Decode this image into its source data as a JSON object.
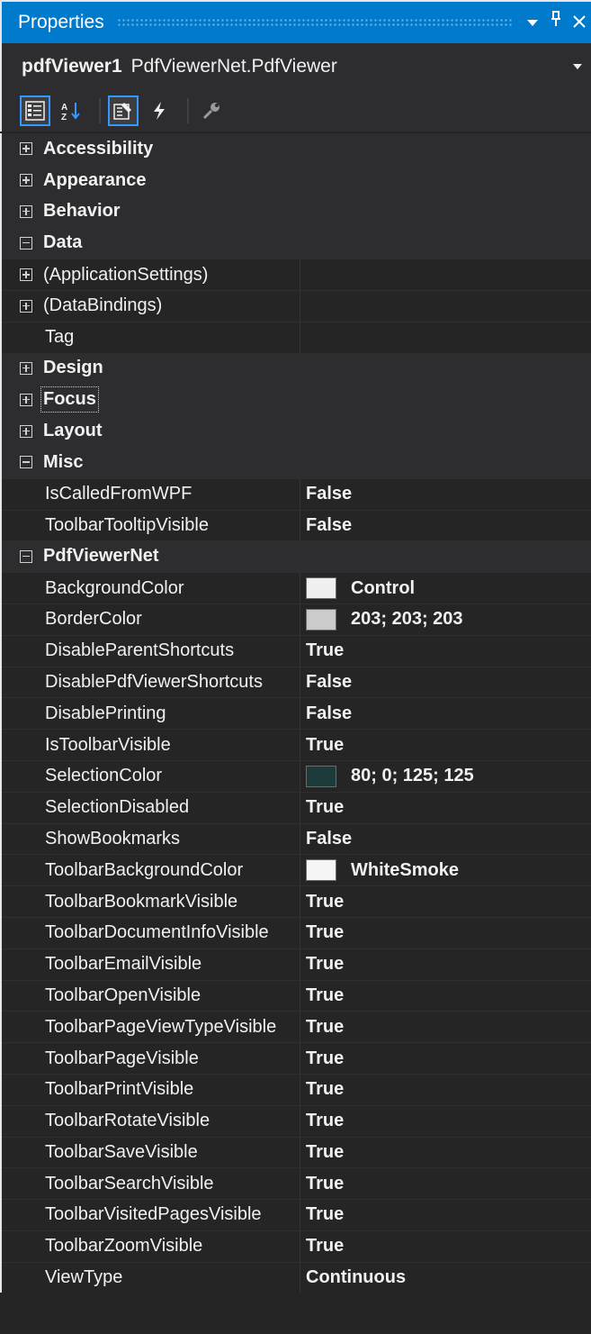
{
  "window": {
    "title": "Properties",
    "pin_glyph": "â ¦",
    "close_glyph": "Ã"
  },
  "object_selector": {
    "name": "pdfViewer1",
    "type": "PdfViewerNet.PdfViewer"
  },
  "toolbar": {
    "buttons": [
      "categorized-icon",
      "alphabetical-icon",
      "properties-icon",
      "events-icon",
      "property-pages-icon"
    ]
  },
  "colors": {
    "accent": "#007acc",
    "background": "#252526",
    "category_row": "#2d2d30",
    "text": "#f1f1f1"
  },
  "rows": [
    {
      "kind": "category",
      "expanded": false,
      "label": "Accessibility"
    },
    {
      "kind": "category",
      "expanded": false,
      "label": "Appearance"
    },
    {
      "kind": "category",
      "expanded": false,
      "label": "Behavior"
    },
    {
      "kind": "category",
      "expanded": true,
      "label": "Data"
    },
    {
      "kind": "property",
      "expandable": true,
      "label": "(ApplicationSettings)",
      "value": ""
    },
    {
      "kind": "property",
      "expandable": true,
      "label": "(DataBindings)",
      "value": ""
    },
    {
      "kind": "property",
      "expandable": false,
      "label": "Tag",
      "value": ""
    },
    {
      "kind": "category",
      "expanded": false,
      "label": "Design"
    },
    {
      "kind": "category",
      "expanded": false,
      "label": "Focus",
      "focused": true
    },
    {
      "kind": "category",
      "expanded": false,
      "label": "Layout"
    },
    {
      "kind": "category",
      "expanded": true,
      "label": "Misc"
    },
    {
      "kind": "property",
      "label": "IsCalledFromWPF",
      "value": "False"
    },
    {
      "kind": "property",
      "label": "ToolbarTooltipVisible",
      "value": "False"
    },
    {
      "kind": "category",
      "expanded": true,
      "label": "PdfViewerNet"
    },
    {
      "kind": "property",
      "label": "BackgroundColor",
      "value": "Control",
      "swatch": "#f0f0f0"
    },
    {
      "kind": "property",
      "label": "BorderColor",
      "value": "203; 203; 203",
      "swatch": "#cbcbcb"
    },
    {
      "kind": "property",
      "label": "DisableParentShortcuts",
      "value": "True"
    },
    {
      "kind": "property",
      "label": "DisablePdfViewerShortcuts",
      "value": "False"
    },
    {
      "kind": "property",
      "label": "DisablePrinting",
      "value": "False"
    },
    {
      "kind": "property",
      "label": "IsToolbarVisible",
      "value": "True"
    },
    {
      "kind": "property",
      "label": "SelectionColor",
      "value": "80; 0; 125; 125",
      "swatch": "#1c3a3a"
    },
    {
      "kind": "property",
      "label": "SelectionDisabled",
      "value": "True"
    },
    {
      "kind": "property",
      "label": "ShowBookmarks",
      "value": "False"
    },
    {
      "kind": "property",
      "label": "ToolbarBackgroundColor",
      "value": "WhiteSmoke",
      "swatch": "#f5f5f5"
    },
    {
      "kind": "property",
      "label": "ToolbarBookmarkVisible",
      "value": "True"
    },
    {
      "kind": "property",
      "label": "ToolbarDocumentInfoVisible",
      "value": "True"
    },
    {
      "kind": "property",
      "label": "ToolbarEmailVisible",
      "value": "True"
    },
    {
      "kind": "property",
      "label": "ToolbarOpenVisible",
      "value": "True"
    },
    {
      "kind": "property",
      "label": "ToolbarPageViewTypeVisible",
      "value": "True"
    },
    {
      "kind": "property",
      "label": "ToolbarPageVisible",
      "value": "True"
    },
    {
      "kind": "property",
      "label": "ToolbarPrintVisible",
      "value": "True"
    },
    {
      "kind": "property",
      "label": "ToolbarRotateVisible",
      "value": "True"
    },
    {
      "kind": "property",
      "label": "ToolbarSaveVisible",
      "value": "True"
    },
    {
      "kind": "property",
      "label": "ToolbarSearchVisible",
      "value": "True"
    },
    {
      "kind": "property",
      "label": "ToolbarVisitedPagesVisible",
      "value": "True"
    },
    {
      "kind": "property",
      "label": "ToolbarZoomVisible",
      "value": "True"
    },
    {
      "kind": "property",
      "label": "ViewType",
      "value": "Continuous"
    }
  ]
}
